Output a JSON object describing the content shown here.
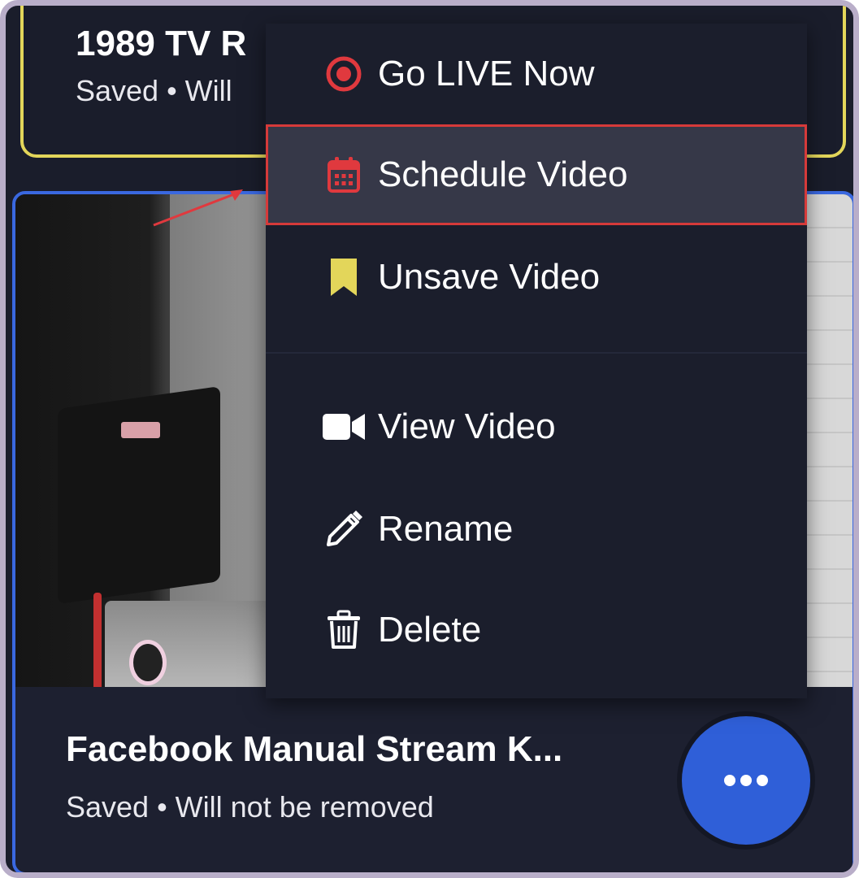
{
  "top_card": {
    "title": "1989 TV R",
    "subtitle": "Saved • Will"
  },
  "bottom_card": {
    "title": "Facebook Manual Stream K...",
    "subtitle": "Saved • Will not be removed",
    "more_button_icon": "more-horizontal-icon"
  },
  "menu": {
    "items": [
      {
        "label": "Go LIVE Now",
        "icon": "record-icon",
        "icon_color": "#e0393e"
      },
      {
        "label": "Schedule Video",
        "icon": "calendar-icon",
        "icon_color": "#e0393e",
        "highlighted": true
      },
      {
        "label": "Unsave Video",
        "icon": "bookmark-icon",
        "icon_color": "#e3d65a"
      },
      {
        "label": "View Video",
        "icon": "video-camera-icon",
        "icon_color": "#ffffff"
      },
      {
        "label": "Rename",
        "icon": "pencil-icon",
        "icon_color": "#ffffff"
      },
      {
        "label": "Delete",
        "icon": "trash-icon",
        "icon_color": "#ffffff"
      }
    ]
  },
  "colors": {
    "background": "#1a1d2b",
    "accent_blue": "#2f5fd8",
    "highlight_outline": "#d63a3a",
    "saved_card_border": "#e3d65a"
  }
}
